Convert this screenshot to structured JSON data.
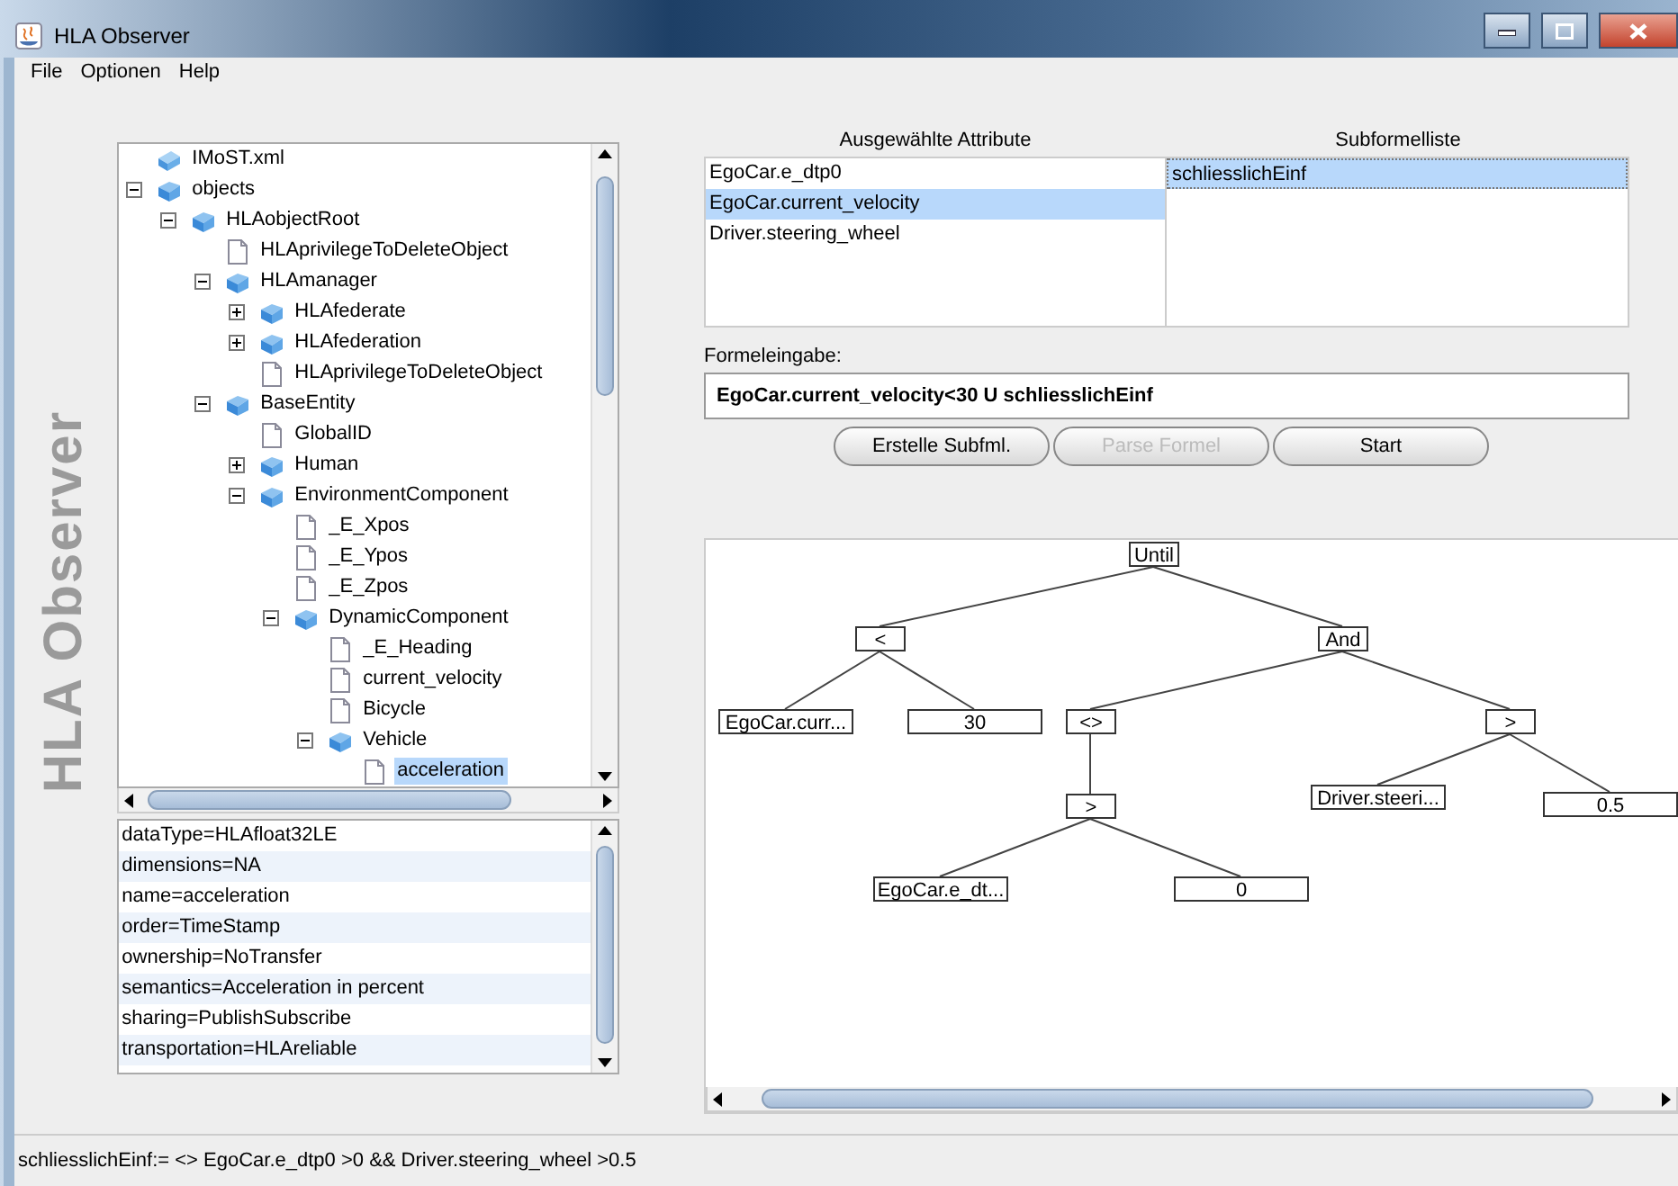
{
  "window": {
    "title": "HLA Observer"
  },
  "menu": [
    "File",
    "Optionen",
    "Help"
  ],
  "logo": "HLA Observer",
  "tree": [
    {
      "label": "IMoST.xml",
      "kind": "xml",
      "selected": false
    },
    {
      "label": "objects",
      "kind": "class",
      "expanded": true,
      "selected": false,
      "children": [
        {
          "label": "HLAobjectRoot",
          "kind": "class",
          "expanded": true,
          "selected": false,
          "children": [
            {
              "label": "HLAprivilegeToDeleteObject",
              "kind": "attribute",
              "selected": false
            },
            {
              "label": "HLAmanager",
              "kind": "class",
              "expanded": true,
              "selected": false,
              "children": [
                {
                  "label": "HLAfederate",
                  "kind": "class",
                  "expanded": false,
                  "selected": false
                },
                {
                  "label": "HLAfederation",
                  "kind": "class",
                  "expanded": false,
                  "selected": false
                },
                {
                  "label": "HLAprivilegeToDeleteObject",
                  "kind": "attribute",
                  "selected": false
                }
              ]
            },
            {
              "label": "BaseEntity",
              "kind": "class",
              "expanded": true,
              "selected": false,
              "children": [
                {
                  "label": "GlobalID",
                  "kind": "attribute",
                  "selected": false
                },
                {
                  "label": "Human",
                  "kind": "class",
                  "expanded": false,
                  "selected": false
                },
                {
                  "label": "EnvironmentComponent",
                  "kind": "class",
                  "expanded": true,
                  "selected": false,
                  "children": [
                    {
                      "label": "_E_Xpos",
                      "kind": "attribute",
                      "selected": false
                    },
                    {
                      "label": "_E_Ypos",
                      "kind": "attribute",
                      "selected": false
                    },
                    {
                      "label": "_E_Zpos",
                      "kind": "attribute",
                      "selected": false
                    },
                    {
                      "label": "DynamicComponent",
                      "kind": "class",
                      "expanded": true,
                      "selected": false,
                      "children": [
                        {
                          "label": "_E_Heading",
                          "kind": "attribute",
                          "selected": false
                        },
                        {
                          "label": "current_velocity",
                          "kind": "attribute",
                          "selected": false
                        },
                        {
                          "label": "Bicycle",
                          "kind": "attribute",
                          "selected": false
                        },
                        {
                          "label": "Vehicle",
                          "kind": "class",
                          "expanded": true,
                          "selected": false,
                          "children": [
                            {
                              "label": "acceleration",
                              "kind": "attribute",
                              "selected": true
                            }
                          ]
                        }
                      ]
                    }
                  ]
                }
              ]
            }
          ]
        }
      ]
    }
  ],
  "properties": [
    "dataType=HLAfloat32LE",
    "dimensions=NA",
    "name=acceleration",
    "order=TimeStamp",
    "ownership=NoTransfer",
    "semantics=Acceleration in percent",
    "sharing=PublishSubscribe",
    "transportation=HLAreliable"
  ],
  "selected_attributes": {
    "title": "Ausgewählte Attribute",
    "items": [
      {
        "label": "EgoCar.e_dtp0",
        "selected": false
      },
      {
        "label": "EgoCar.current_velocity",
        "selected": true
      },
      {
        "label": "Driver.steering_wheel",
        "selected": false
      }
    ]
  },
  "subformulas": {
    "title": "Subformelliste",
    "items": [
      {
        "label": "schliesslichEinf",
        "selected": true
      }
    ]
  },
  "formula": {
    "label": "Formeleingabe:",
    "value": "EgoCar.current_velocity<30 U schliesslichEinf"
  },
  "buttons": [
    {
      "label": "Erstelle Subfml.",
      "disabled": false
    },
    {
      "label": "Parse Formel",
      "disabled": true
    },
    {
      "label": "Start",
      "disabled": false
    }
  ],
  "formula_tree": {
    "label": "Until",
    "kind": "operator",
    "children": [
      {
        "label": "<",
        "kind": "operator",
        "children": [
          {
            "label": "EgoCar.curr...",
            "kind": "operand"
          },
          {
            "label": "30",
            "kind": "operand"
          }
        ]
      },
      {
        "label": "And",
        "kind": "operator",
        "children": [
          {
            "label": "<>",
            "kind": "operator",
            "children": [
              {
                "label": ">",
                "kind": "operator",
                "children": [
                  {
                    "label": "EgoCar.e_dt...",
                    "kind": "operand"
                  },
                  {
                    "label": "0",
                    "kind": "operand"
                  }
                ]
              }
            ]
          },
          {
            "label": ">",
            "kind": "operator",
            "children": [
              {
                "label": "Driver.steeri...",
                "kind": "operand"
              },
              {
                "label": "0.5",
                "kind": "operand"
              }
            ]
          }
        ]
      }
    ]
  },
  "status_bar": "schliesslichEinf:= <> EgoCar.e_dtp0 >0 && Driver.steering_wheel >0.5"
}
